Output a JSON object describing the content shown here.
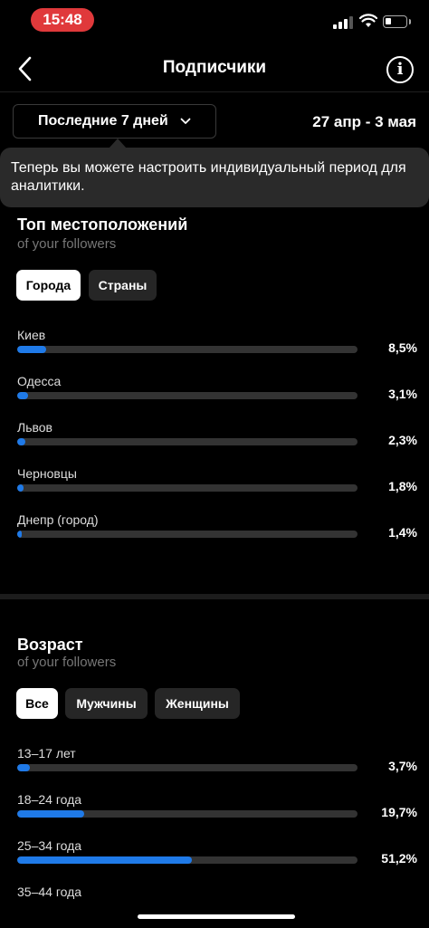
{
  "status": {
    "time": "15:48"
  },
  "nav": {
    "title": "Подписчики"
  },
  "period": {
    "label": "Последние 7 дней",
    "range": "27 апр - 3 мая"
  },
  "tooltip": {
    "text": "Теперь вы можете настроить индивидуальный период для аналитики."
  },
  "locations": {
    "title": "Топ местоположений",
    "subtitle": "of your followers",
    "tabs": [
      {
        "label": "Города",
        "active": true
      },
      {
        "label": "Страны",
        "active": false
      }
    ],
    "rows": [
      {
        "label": "Киев",
        "value": 8.5,
        "display": "8,5%"
      },
      {
        "label": "Одесса",
        "value": 3.1,
        "display": "3,1%"
      },
      {
        "label": "Львов",
        "value": 2.3,
        "display": "2,3%"
      },
      {
        "label": "Черновцы",
        "value": 1.8,
        "display": "1,8%"
      },
      {
        "label": "Днепр (город)",
        "value": 1.4,
        "display": "1,4%"
      }
    ]
  },
  "age": {
    "title": "Возраст",
    "subtitle": "of your followers",
    "tabs": [
      {
        "label": "Все",
        "active": true
      },
      {
        "label": "Мужчины",
        "active": false
      },
      {
        "label": "Женщины",
        "active": false
      }
    ],
    "rows": [
      {
        "label": "13–17 лет",
        "value": 3.7,
        "display": "3,7%"
      },
      {
        "label": "18–24 года",
        "value": 19.7,
        "display": "19,7%"
      },
      {
        "label": "25–34 года",
        "value": 51.2,
        "display": "51,2%"
      },
      {
        "label": "35–44 года",
        "value": null,
        "display": ""
      }
    ]
  },
  "colors": {
    "accent": "#1f7ae8",
    "time_pill": "#e0393b",
    "track": "#333333"
  }
}
